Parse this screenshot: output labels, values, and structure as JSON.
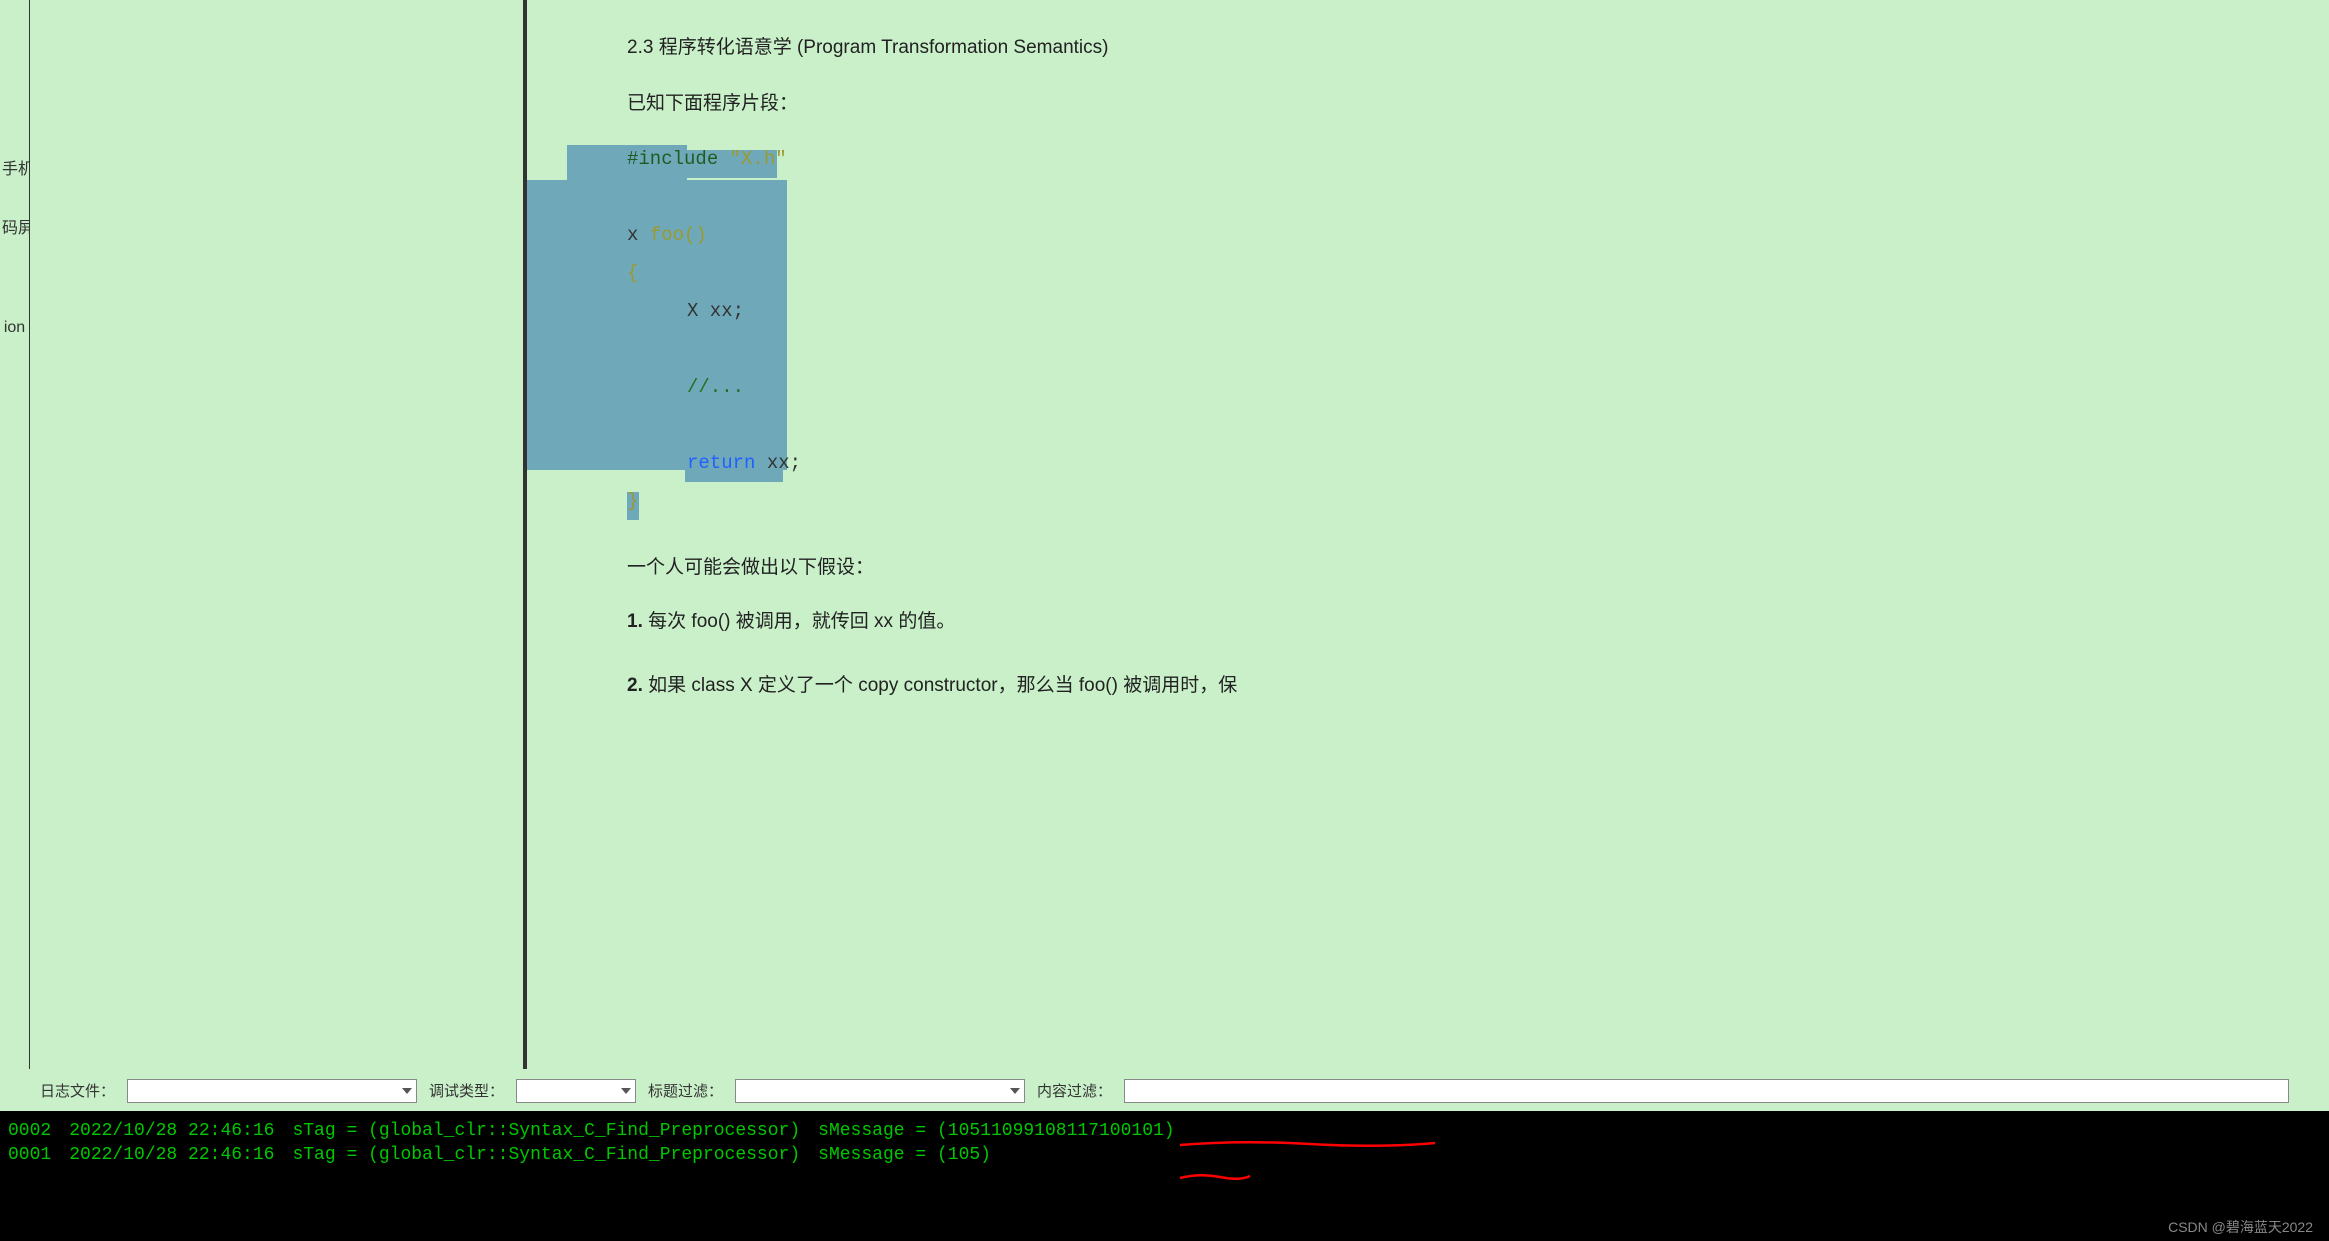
{
  "sidebar": {
    "items": [
      {
        "label": "手机"
      },
      {
        "label": "码屏"
      },
      {
        "label": ""
      },
      {
        "label": "ion"
      }
    ]
  },
  "doc": {
    "section_title": "2.3  程序转化语意学  (Program Transformation Semantics)",
    "intro": "已知下面程序片段：",
    "code": {
      "include_kw": "#include",
      "include_str": " \"X.h\"",
      "fn_ret": "x ",
      "fn_name": "foo()",
      "open": "{",
      "decl": "X xx;",
      "comment": "//...",
      "return_kw": "return ",
      "return_expr": "xx;",
      "close": "}"
    },
    "assumption_title": "一个人可能会做出以下假设：",
    "assumptions": [
      {
        "num": "1.",
        "text": " 每次 foo() 被调用，就传回 xx 的值。"
      },
      {
        "num": "2.",
        "text": " 如果 class X 定义了一个 copy constructor，那么当 foo() 被调用时，保"
      }
    ]
  },
  "filters": {
    "log_file_label": "日志文件：",
    "debug_type_label": "调试类型：",
    "title_filter_label": "标题过滤：",
    "content_filter_label": "内容过滤："
  },
  "console": {
    "rows": [
      {
        "idx": "0002",
        "ts": "2022/10/28 22:46:16",
        "tag": "sTag = (global_clr::Syntax_C_Find_Preprocessor)",
        "msg": "sMessage = (10511099108117100101)"
      },
      {
        "idx": "0001",
        "ts": "2022/10/28 22:46:16",
        "tag": "sTag = (global_clr::Syntax_C_Find_Preprocessor)",
        "msg": "sMessage = (105)"
      }
    ]
  },
  "watermark": "CSDN @碧海蓝天2022"
}
